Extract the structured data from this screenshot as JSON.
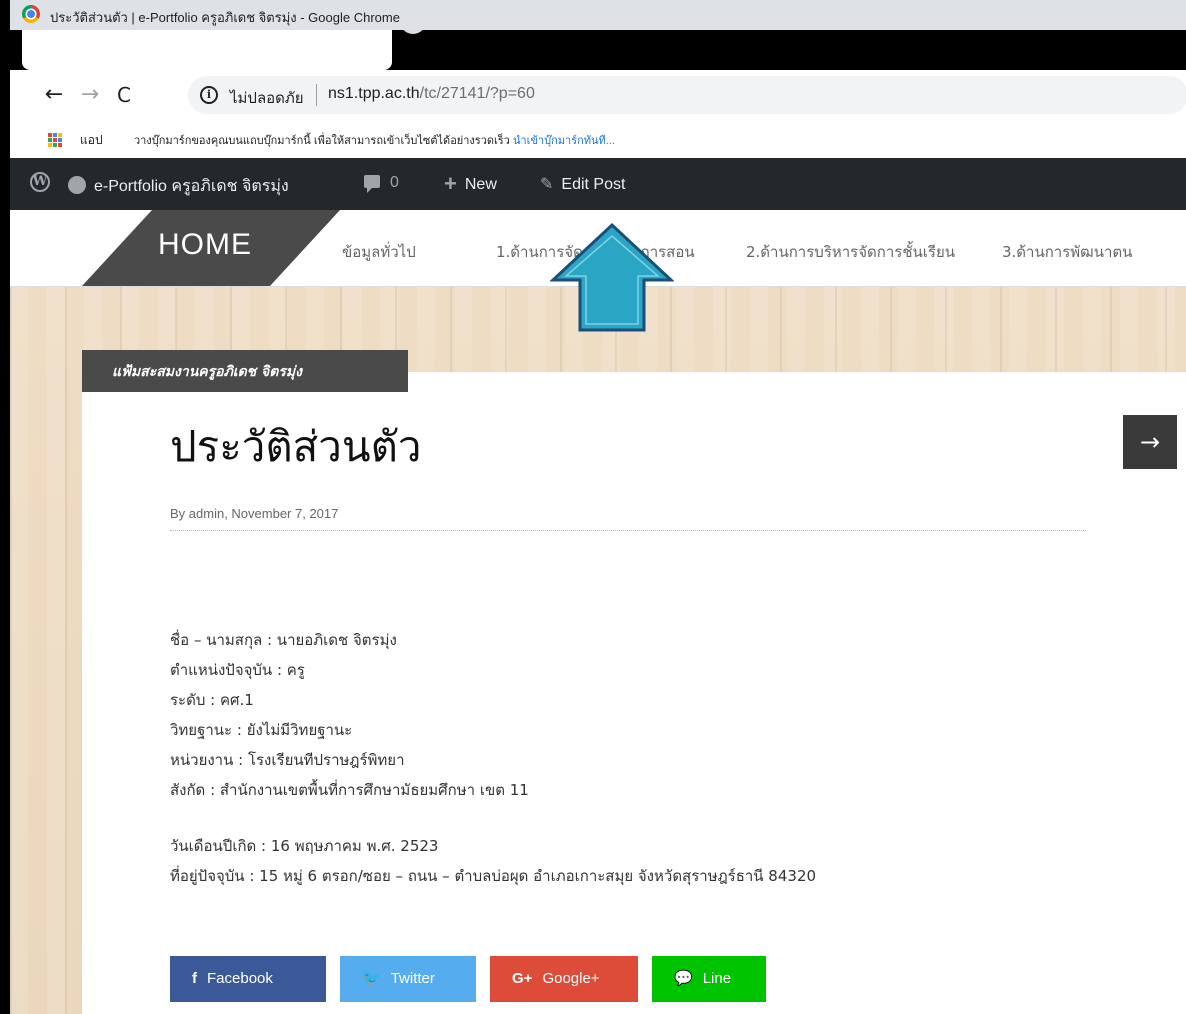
{
  "window": {
    "title": "ประวัติส่วนตัว | e-Portfolio ครูอภิเดช จิตรมุ่ง - Google Chrome"
  },
  "toolbar": {
    "back": "←",
    "forward": "→",
    "reload": "C",
    "security_label": "ไม่ปลอดภัย",
    "url_host": "ns1.tpp.ac.th",
    "url_path": "/tc/27141/?p=60"
  },
  "bookmarks": {
    "apps_label": "แอป",
    "hint": "วางบุ๊กมาร์กของคุณบนแถบบุ๊กมาร์กนี้ เพื่อให้สามารถเข้าเว็บไซต์ได้อย่างรวดเร็ว",
    "import_link": "นำเข้าบุ๊กมาร์กทันที..."
  },
  "adminbar": {
    "site_name": "e-Portfolio ครูอภิเดช จิตรมุ่ง",
    "comment_count": "0",
    "new_label": "New",
    "edit_label": "Edit Post"
  },
  "nav": {
    "home": "HOME",
    "items": [
      "ข้อมูลทั่วไป",
      "1.ด้านการจัดการเรียนการสอน",
      "2.ด้านการบริหารจัดการชั้นเรียน",
      "3.ด้านการพัฒนาตน"
    ]
  },
  "post": {
    "category": "แฟ้มสะสมงานครูอภิเดช จิตรมุ่ง",
    "title": "ประวัติส่วนตัว",
    "byline": "By admin, November 7, 2017",
    "next": "→",
    "lines": [
      "ชื่อ – นามสกุล : นายอภิเดช จิตรมุ่ง",
      "ตำแหน่งปัจจุบัน : ครู",
      "ระดับ : คศ.1",
      "วิทยฐานะ : ยังไม่มีวิทยฐานะ",
      "หน่วยงาน : โรงเรียนทีปราษฎร์พิทยา",
      "สังกัด : สำนักงานเขตพื้นที่การศึกษามัธยมศึกษา เขต 11",
      "วันเดือนปีเกิด : 16 พฤษภาคม พ.ศ. 2523",
      "ที่อยู่ปัจจุบัน : 15 หมู่ 6 ตรอก/ซอย – ถนน – ตำบลบ่อผุด อำเภอเกาะสมุย จังหวัดสุราษฎร์ธานี 84320"
    ]
  },
  "share": {
    "facebook": "Facebook",
    "facebook_icon": "f",
    "twitter": "Twitter",
    "twitter_icon": "🐦",
    "google": "Google+",
    "google_icon": "G+",
    "line": "Line",
    "line_icon": "💬"
  },
  "colors": {
    "adminbar": "#23282d",
    "home_tab": "#4a4a4a",
    "annotation_arrow": "#2aa6c4",
    "facebook": "#3b5998",
    "twitter": "#55acee",
    "google": "#dd4b39",
    "line": "#00c300"
  }
}
